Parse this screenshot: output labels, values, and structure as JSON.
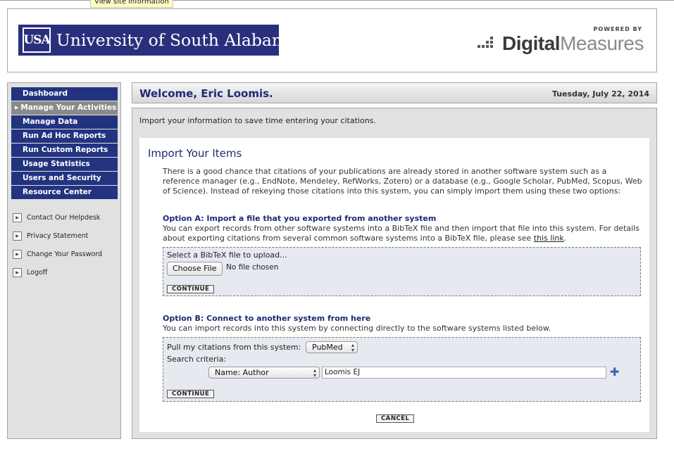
{
  "tooltip": "View site information",
  "header": {
    "university_mark": "USA",
    "university_name": "University of South Alabama",
    "vendor_powered": "POWERED BY",
    "vendor_name_bold": "Digital",
    "vendor_name_light": "Measures"
  },
  "sidebar": {
    "nav": [
      {
        "label": "Dashboard"
      },
      {
        "label": "Manage Your Activities",
        "active": true
      },
      {
        "label": "Manage Data"
      },
      {
        "label": "Run Ad Hoc Reports"
      },
      {
        "label": "Run Custom Reports"
      },
      {
        "label": "Usage Statistics"
      },
      {
        "label": "Users and Security"
      },
      {
        "label": "Resource Center"
      }
    ],
    "links": [
      {
        "label": "Contact Our Helpdesk"
      },
      {
        "label": "Privacy Statement"
      },
      {
        "label": "Change Your Password"
      },
      {
        "label": "Logoff"
      }
    ]
  },
  "welcome": {
    "text": "Welcome, Eric Loomis.",
    "date": "Tuesday, July 22, 2014"
  },
  "main": {
    "intro": "Import your information to save time entering your citations.",
    "title": "Import Your Items",
    "description": "There is a good chance that citations of your publications are already stored in another software system such as a reference manager (e.g., EndNote, Mendeley, RefWorks, Zotero) or a database (e.g., Google Scholar, PubMed, Scopus, Web of Science). Instead of rekeying those citations into this system, you can simply import them using these two options:",
    "option_a": {
      "title": "Option A: Import a file that you exported from another system",
      "desc": "You can export records from other software systems into a BibTeX file and then import that file into this system. For details about exporting citations from several common software systems into a BibTeX file, please see",
      "link": "this link",
      "link_suffix": ".",
      "upload_label": "Select a BibTeX file to upload...",
      "choose_file": "Choose File",
      "no_file": "No file chosen",
      "continue": "CONTINUE"
    },
    "option_b": {
      "title": "Option B: Connect to another system from here",
      "desc": "You can import records into this system by connecting directly to the software systems listed below.",
      "pull_label": "Pull my citations from this system:",
      "system_value": "PubMed",
      "criteria_label": "Search criteria:",
      "criteria_field": "Name: Author",
      "criteria_value": "Loomis EJ",
      "continue": "CONTINUE"
    },
    "cancel": "CANCEL"
  },
  "colors": {
    "nav_bg": "#223480",
    "nav_active_bg": "#8a8a8a",
    "title_blue": "#1d2a74",
    "usa_blue": "#2a2f7d"
  }
}
